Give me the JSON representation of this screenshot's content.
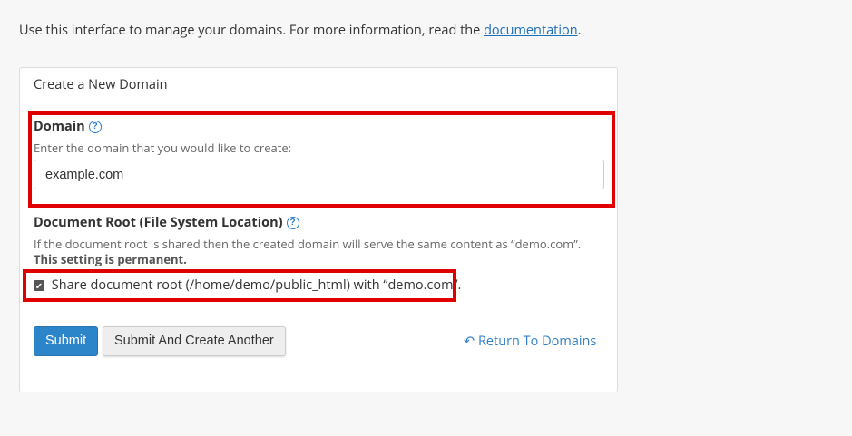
{
  "intro": {
    "text": "Use this interface to manage your domains. For more information, read the ",
    "link_label": "documentation",
    "suffix": "."
  },
  "panel": {
    "heading": "Create a New Domain"
  },
  "domain_field": {
    "label": "Domain",
    "hint": "Enter the domain that you would like to create:",
    "value": "example.com",
    "help_icon": "question-circle-icon"
  },
  "doc_root": {
    "label": "Document Root (File System Location)",
    "help_icon": "question-circle-icon",
    "hint": "If the document root is shared then the created domain will serve the same content as “demo.com”.",
    "permanent_note": "This setting is permanent.",
    "checkbox_label": "Share document root (/home/demo/public_html) with “demo.com”.",
    "checkbox_checked": true
  },
  "actions": {
    "submit_label": "Submit",
    "submit_another_label": "Submit And Create Another",
    "return_label": "Return To Domains",
    "return_icon": "undo-arrow-icon"
  },
  "colors": {
    "highlight": "#e00000",
    "primary": "#2d85c9",
    "link": "#2f7fc8"
  }
}
